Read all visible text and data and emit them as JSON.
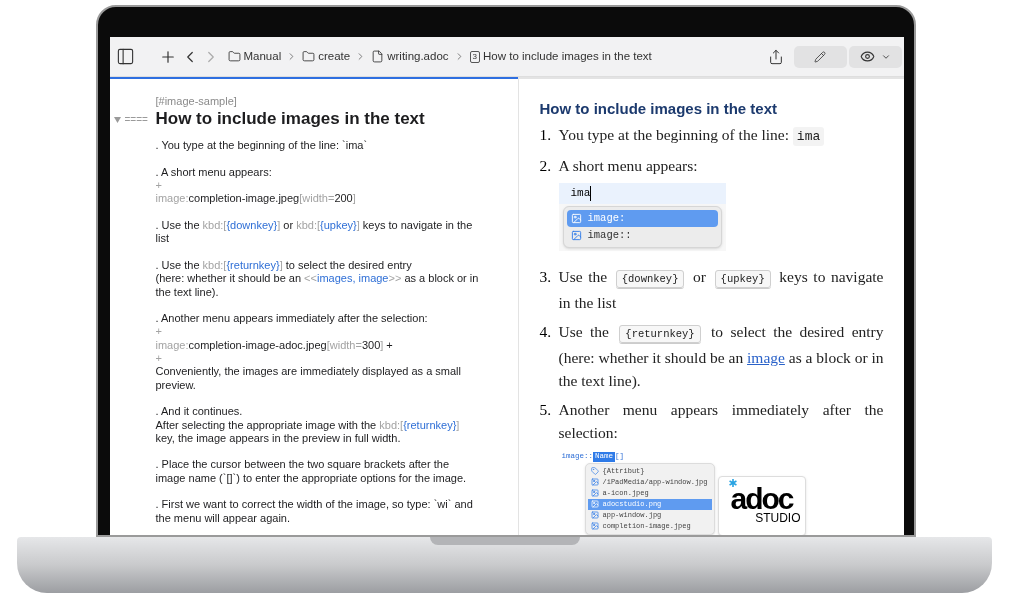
{
  "toolbar": {
    "breadcrumbs": [
      {
        "kind": "folder",
        "label": "Manual"
      },
      {
        "kind": "folder",
        "label": "create"
      },
      {
        "kind": "file",
        "label": "writing.adoc"
      },
      {
        "kind": "section",
        "badge": "3",
        "label": "How to include images in the text"
      }
    ]
  },
  "editor": {
    "focused": true,
    "anchor": "[#image-sample]",
    "heading": {
      "expanded": true,
      "marker": "====",
      "text": "How to include images in the text"
    },
    "paragraphs": [
      [
        [
          {
            "kind": "plain",
            "text": ". You type at the beginning of the line: `ima`"
          }
        ]
      ],
      [
        [
          {
            "kind": "plain",
            "text": ". A short menu appears:"
          }
        ],
        [
          {
            "kind": "markup",
            "text": "+"
          }
        ],
        [
          {
            "kind": "markup",
            "text": "image:"
          },
          {
            "kind": "plain",
            "text": "completion-image.jpeg"
          },
          {
            "kind": "markup",
            "text": "[width="
          },
          {
            "kind": "plain",
            "text": "200"
          },
          {
            "kind": "markup",
            "text": "]"
          }
        ]
      ],
      [
        [
          {
            "kind": "plain",
            "text": ". Use the "
          },
          {
            "kind": "markup",
            "text": "kbd:["
          },
          {
            "kind": "link",
            "text": "{downkey}"
          },
          {
            "kind": "markup",
            "text": "]"
          },
          {
            "kind": "plain",
            "text": " or "
          },
          {
            "kind": "markup",
            "text": "kbd:["
          },
          {
            "kind": "link",
            "text": "{upkey}"
          },
          {
            "kind": "markup",
            "text": "]"
          },
          {
            "kind": "plain",
            "text": " keys to navigate in the"
          }
        ],
        [
          {
            "kind": "plain",
            "text": "list"
          }
        ]
      ],
      [
        [
          {
            "kind": "plain",
            "text": ". Use the "
          },
          {
            "kind": "markup",
            "text": "kbd:["
          },
          {
            "kind": "link",
            "text": "{returnkey}"
          },
          {
            "kind": "markup",
            "text": "]"
          },
          {
            "kind": "plain",
            "text": " to select the desired entry"
          }
        ],
        [
          {
            "kind": "plain",
            "text": "(here: whether it should be an "
          },
          {
            "kind": "markup",
            "text": "<<"
          },
          {
            "kind": "link",
            "text": "images, image"
          },
          {
            "kind": "markup",
            "text": ">>"
          },
          {
            "kind": "plain",
            "text": " as a block or in"
          }
        ],
        [
          {
            "kind": "plain",
            "text": "the text line)."
          }
        ]
      ],
      [
        [
          {
            "kind": "plain",
            "text": ". Another menu appears immediately after the selection:"
          }
        ],
        [
          {
            "kind": "markup",
            "text": "+"
          }
        ],
        [
          {
            "kind": "markup",
            "text": "image:"
          },
          {
            "kind": "plain",
            "text": "completion-image-adoc.jpeg"
          },
          {
            "kind": "markup",
            "text": "[width="
          },
          {
            "kind": "plain",
            "text": "300"
          },
          {
            "kind": "markup",
            "text": "]"
          },
          {
            "kind": "plain",
            "text": " +"
          }
        ],
        [
          {
            "kind": "markup",
            "text": "+"
          }
        ],
        [
          {
            "kind": "plain",
            "text": "Conveniently, the images are immediately displayed as a small"
          }
        ],
        [
          {
            "kind": "plain",
            "text": "preview."
          }
        ]
      ],
      [
        [
          {
            "kind": "plain",
            "text": ". And it continues."
          }
        ],
        [
          {
            "kind": "plain",
            "text": "After selecting the appropriate image with the "
          },
          {
            "kind": "markup",
            "text": "kbd:["
          },
          {
            "kind": "link",
            "text": "{returnkey}"
          },
          {
            "kind": "markup",
            "text": "]"
          }
        ],
        [
          {
            "kind": "plain",
            "text": "key, the image appears in the preview in full width."
          }
        ]
      ],
      [
        [
          {
            "kind": "plain",
            "text": ". Place the cursor between the two square brackets after the"
          }
        ],
        [
          {
            "kind": "plain",
            "text": "image name (`[]`) to enter the appropriate options for the image."
          }
        ]
      ],
      [
        [
          {
            "kind": "plain",
            "text": ". First we want to correct the width of the image, so type: `wi` and"
          }
        ],
        [
          {
            "kind": "plain",
            "text": "the menu will appear again."
          }
        ]
      ]
    ]
  },
  "preview": {
    "heading": "How to include images in the text",
    "items": [
      {
        "number": "1.",
        "content": [
          {
            "kind": "plain",
            "text": "You type at the beginning of the line: "
          },
          {
            "kind": "code",
            "text": "ima"
          }
        ]
      },
      {
        "number": "2.",
        "content": [
          {
            "kind": "plain",
            "text": "A short menu appears:"
          }
        ],
        "figure": {
          "kind": "completion",
          "typed": "ima",
          "options": [
            {
              "label": "image:",
              "selected": true
            },
            {
              "label": "image::",
              "selected": false
            }
          ]
        }
      },
      {
        "number": "3.",
        "content": [
          {
            "kind": "plain",
            "text": "Use the "
          },
          {
            "kind": "kbd",
            "text": "{downkey}"
          },
          {
            "kind": "plain",
            "text": " or "
          },
          {
            "kind": "kbd",
            "text": "{upkey}"
          },
          {
            "kind": "plain",
            "text": " keys to navigate in the list"
          }
        ]
      },
      {
        "number": "4.",
        "content": [
          {
            "kind": "plain",
            "text": "Use the "
          },
          {
            "kind": "kbd",
            "text": "{returnkey}"
          },
          {
            "kind": "plain",
            "text": " to select the desired entry (here: whether it should be an "
          },
          {
            "kind": "link",
            "text": "image"
          },
          {
            "kind": "plain",
            "text": " as a block or in the text line)."
          }
        ]
      },
      {
        "number": "5.",
        "content": [
          {
            "kind": "plain",
            "text": "Another menu appears immediately after the selection:"
          }
        ],
        "figure": {
          "kind": "attributes",
          "prefix": "image::",
          "token": "Name",
          "suffix": "[]",
          "options": [
            {
              "kind": "attribute",
              "label": "{Attribut}",
              "selected": false
            },
            {
              "kind": "image",
              "label": "/iPadMedia/app-window.jpg",
              "selected": false
            },
            {
              "kind": "image",
              "label": "a-icon.jpeg",
              "selected": false
            },
            {
              "kind": "image",
              "label": "adocstudio.png",
              "selected": true
            },
            {
              "kind": "image",
              "label": "app-window.jpg",
              "selected": false
            },
            {
              "kind": "image",
              "label": "completion-image.jpeg",
              "selected": false
            }
          ],
          "logo": {
            "word": "adoc",
            "sub": "STUDIO"
          }
        }
      }
    ]
  }
}
